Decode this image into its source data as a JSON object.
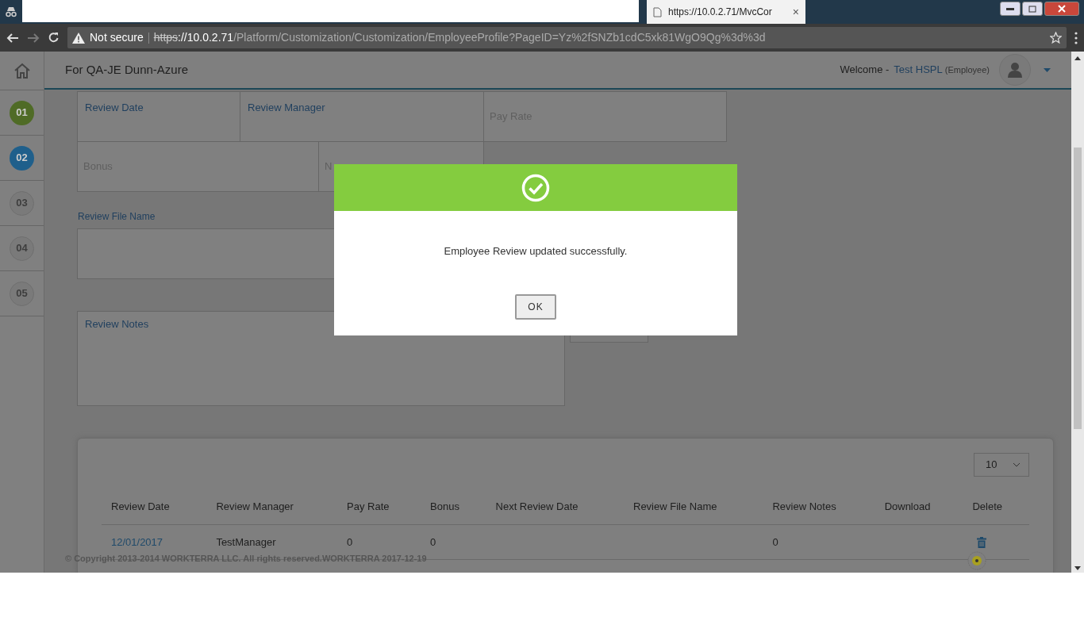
{
  "browser": {
    "tab": {
      "title": "https://10.0.2.71/MvcCor",
      "close": "×"
    },
    "address": {
      "security": "Not secure",
      "scheme": "https",
      "host": "://10.0.2.71",
      "path": "/Platform/Customization/Customization/EmployeeProfile?PageID=Yz%2fSNZb1cdC5xk81WgO9Qg%3d%3d"
    }
  },
  "sidebar": {
    "steps": [
      {
        "label": "01",
        "color": "#4f6b26"
      },
      {
        "label": "02",
        "color": "#1f5f8b"
      },
      {
        "label": "03",
        "color": "#7a7a7a"
      },
      {
        "label": "04",
        "color": "#7a7a7a"
      },
      {
        "label": "05",
        "color": "#7a7a7a"
      }
    ]
  },
  "header": {
    "title": "For QA-JE Dunn-Azure",
    "welcome": "Welcome -",
    "user": "Test HSPL",
    "role": "(Employee)"
  },
  "form": {
    "rows": [
      [
        {
          "text": "Review Date",
          "kind": "label"
        },
        {
          "text": "Review Manager",
          "kind": "label"
        },
        {
          "text": "Pay Rate",
          "kind": "placeholder"
        }
      ],
      [
        {
          "text": "Bonus",
          "kind": "placeholder"
        },
        {
          "text": "N",
          "kind": "placeholder"
        }
      ]
    ],
    "file_label": "Review File Name",
    "notes_label": "Review Notes"
  },
  "table": {
    "page_size": "10",
    "columns": [
      {
        "label": "Review Date",
        "kind": "link"
      },
      {
        "label": "Review Manager",
        "kind": "text"
      },
      {
        "label": "Pay Rate",
        "kind": "text"
      },
      {
        "label": "Bonus",
        "kind": "text"
      },
      {
        "label": "Next Review Date",
        "kind": "text"
      },
      {
        "label": "Review File Name",
        "kind": "text"
      },
      {
        "label": "Review Notes",
        "kind": "text"
      },
      {
        "label": "Download",
        "kind": "text"
      },
      {
        "label": "Delete",
        "kind": "delete"
      }
    ],
    "rows": [
      {
        "cells": [
          "12/01/2017",
          "TestManager",
          "0",
          "0",
          null,
          null,
          "0",
          null,
          null
        ]
      }
    ]
  },
  "footer": {
    "copyright": "© Copyright 2013-2014 WORKTERRA LLC. All rights reserved.WORKTERRA 2017-12-19"
  },
  "modal": {
    "message": "Employee Review updated successfully.",
    "button": "OK"
  }
}
